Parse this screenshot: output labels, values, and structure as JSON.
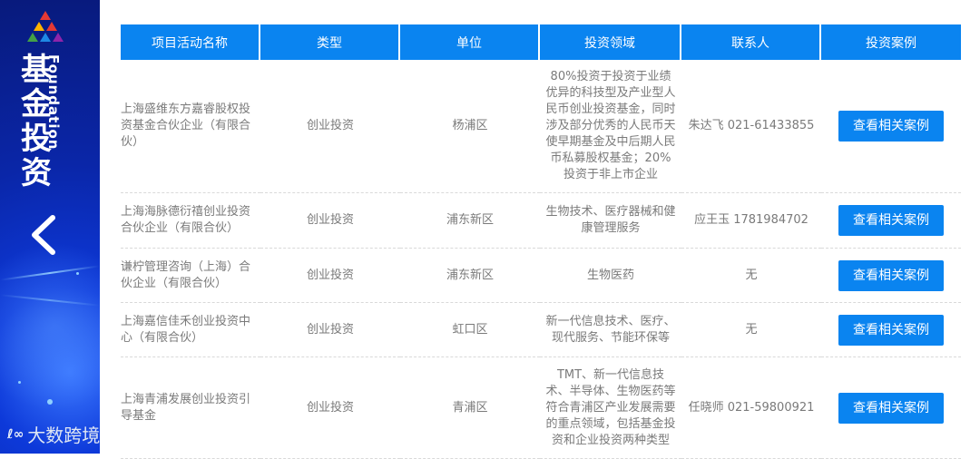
{
  "sidebar": {
    "title_cn": "基金投资",
    "title_en": "Foundation",
    "watermark": "大数跨境"
  },
  "table": {
    "headers": [
      "项目活动名称",
      "类型",
      "单位",
      "投资领域",
      "联系人",
      "投资案例"
    ],
    "rows": [
      {
        "name": "上海盛维东方嘉睿股权投资基金合伙企业（有限合伙）",
        "type": "创业投资",
        "unit": "杨浦区",
        "field": "80%投资于投资于业绩优异的科技型及产业型人民币创业投资基金，同时涉及部分优秀的人民币天使早期基金及中后期人民币私募股权基金；20%投资于非上市企业",
        "contact": "朱达飞 021-61433855",
        "button": "查看相关案例"
      },
      {
        "name": "上海海脉德衍禧创业投资合伙企业（有限合伙）",
        "type": "创业投资",
        "unit": "浦东新区",
        "field": "生物技术、医疗器械和健康管理服务",
        "contact": "应王玉 1781984702",
        "button": "查看相关案例"
      },
      {
        "name": "谦柠管理咨询（上海）合伙企业（有限合伙）",
        "type": "创业投资",
        "unit": "浦东新区",
        "field": "生物医药",
        "contact": "无",
        "button": "查看相关案例"
      },
      {
        "name": "上海嘉信佳禾创业投资中心（有限合伙）",
        "type": "创业投资",
        "unit": "虹口区",
        "field": "新一代信息技术、医疗、现代服务、节能环保等",
        "contact": "无",
        "button": "查看相关案例"
      },
      {
        "name": "上海青浦发展创业投资引导基金",
        "type": "创业投资",
        "unit": "青浦区",
        "field": "TMT、新一代信息技术、半导体、生物医药等符合青浦区产业发展需要的重点领域，包括基金投资和企业投资两种类型",
        "contact": "任晓师 021-59800921",
        "button": "查看相关案例"
      }
    ]
  }
}
